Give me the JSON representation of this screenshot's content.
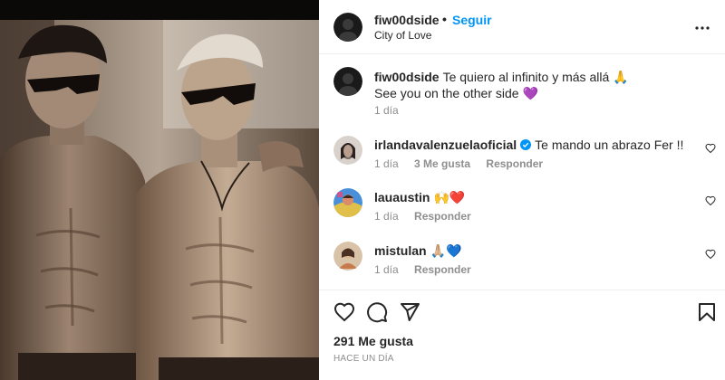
{
  "post": {
    "username": "fiw00dside",
    "dot": "•",
    "follow_label": "Seguir",
    "location": "City of Love",
    "photo_alt": "black and white photo of two shirtless men wearing sunglasses"
  },
  "caption": {
    "username": "fiw00dside",
    "line1": "Te quiero al infinito y más allá 🙏",
    "line2": "See you on the other side 💜",
    "time": "1 día"
  },
  "comments": [
    {
      "username": "irlandavalenzuelaoficial",
      "verified": true,
      "text": "Te mando un abrazo Fer !!",
      "time": "1 día",
      "likes": "3 Me gusta",
      "reply_label": "Responder",
      "avatar_color": "#7a6a66"
    },
    {
      "username": "lauaustin",
      "verified": false,
      "text": "🙌❤️",
      "time": "1 día",
      "likes": "",
      "reply_label": "Responder",
      "avatar_color": "#4a8fd9"
    },
    {
      "username": "mistulan",
      "verified": false,
      "text": "🙏🏼💙",
      "time": "1 día",
      "likes": "",
      "reply_label": "Responder",
      "avatar_color": "#c77a4a"
    }
  ],
  "footer": {
    "likes_count": "291 Me gusta",
    "timestamp": "HACE UN DÍA"
  },
  "icons": {
    "more": "more-options-icon",
    "like": "heart-icon",
    "comment": "comment-icon",
    "share": "send-icon",
    "save": "bookmark-icon",
    "verified": "verified-badge-icon"
  },
  "colors": {
    "accent": "#0095f6",
    "text": "#262626",
    "muted": "#8e8e8e",
    "divider": "#efefef"
  }
}
